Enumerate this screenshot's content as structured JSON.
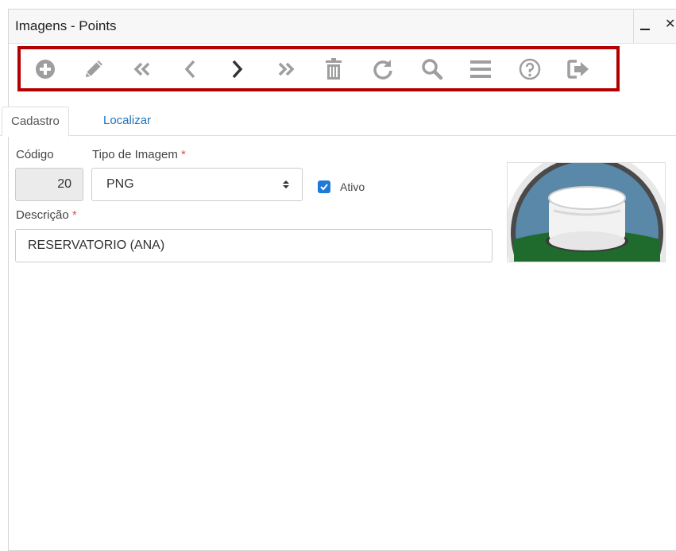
{
  "window": {
    "title": "Imagens - Points",
    "close_glyph": "✕"
  },
  "toolbar": {
    "buttons": [
      {
        "name": "add",
        "icon": "plus-circle-icon"
      },
      {
        "name": "edit",
        "icon": "pencil-icon"
      },
      {
        "name": "first",
        "icon": "double-chevron-left-icon"
      },
      {
        "name": "previous",
        "icon": "chevron-left-icon"
      },
      {
        "name": "next",
        "icon": "chevron-right-icon"
      },
      {
        "name": "last",
        "icon": "double-chevron-right-icon"
      },
      {
        "name": "delete",
        "icon": "trash-icon"
      },
      {
        "name": "refresh",
        "icon": "refresh-icon"
      },
      {
        "name": "search",
        "icon": "search-icon"
      },
      {
        "name": "list",
        "icon": "list-icon"
      },
      {
        "name": "help",
        "icon": "question-circle-icon"
      },
      {
        "name": "exit",
        "icon": "sign-out-icon"
      }
    ],
    "border_color": "#b30000",
    "icon_color": "#9e9e9e"
  },
  "tabs": [
    {
      "label": "Cadastro",
      "active": true
    },
    {
      "label": "Localizar",
      "active": false
    }
  ],
  "form": {
    "codigo": {
      "label": "Código",
      "value": "20"
    },
    "tipo": {
      "label": "Tipo de Imagem",
      "required_mark": "*",
      "value": "PNG"
    },
    "ativo": {
      "label": "Ativo",
      "checked": true
    },
    "descricao": {
      "label": "Descrição",
      "required_mark": "*",
      "value": "RESERVATORIO (ANA)"
    }
  },
  "preview": {
    "icon": "reservoir-tank-icon",
    "colors": {
      "sky": "#5a88a8",
      "ground": "#1f6b2e",
      "tank": "#f2f2f2"
    }
  }
}
